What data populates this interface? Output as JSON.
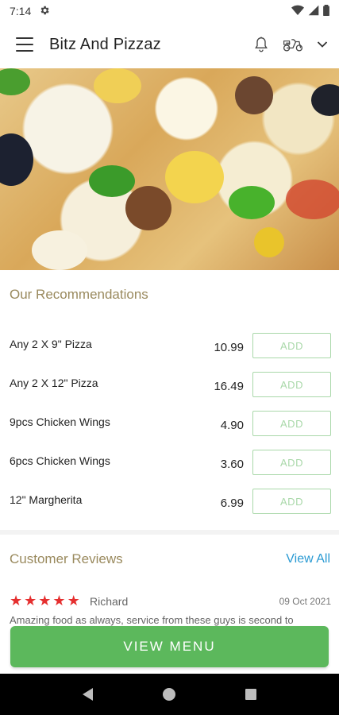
{
  "status_bar": {
    "time": "7:14"
  },
  "app_bar": {
    "title": "Bitz And Pizzaz"
  },
  "recommendations": {
    "title": "Our Recommendations",
    "add_label": "ADD",
    "items": [
      {
        "name": "Any 2 X 9\" Pizza",
        "price": "10.99"
      },
      {
        "name": "Any 2 X 12\" Pizza",
        "price": "16.49"
      },
      {
        "name": "9pcs Chicken Wings",
        "price": "4.90"
      },
      {
        "name": "6pcs Chicken Wings",
        "price": "3.60"
      },
      {
        "name": "12\" Margherita",
        "price": "6.99"
      }
    ]
  },
  "reviews": {
    "title": "Customer Reviews",
    "view_all": "View All",
    "items": [
      {
        "rating": 5,
        "reviewer": "Richard",
        "date": "09 Oct 2021",
        "text": "Amazing food as always, service from these guys is second to"
      }
    ]
  },
  "footer": {
    "view_menu": "VIEW MENU"
  },
  "colors": {
    "accent_green": "#5cb85c",
    "star_red": "#e52f2f",
    "link_blue": "#2a9ad3",
    "section_title": "#9a8a5e"
  }
}
